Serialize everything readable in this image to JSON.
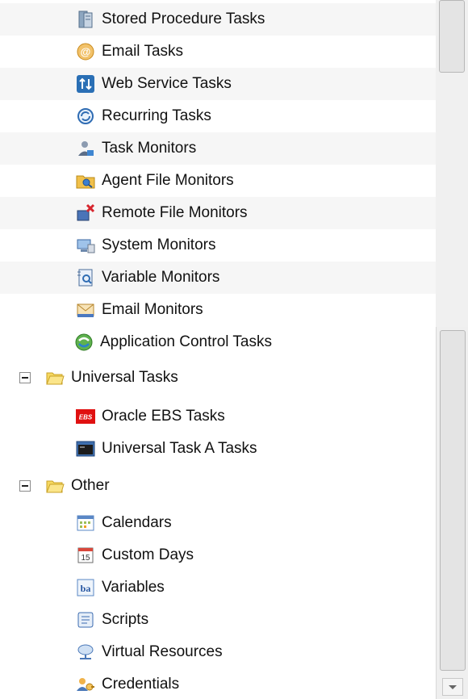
{
  "tree": {
    "task_items_top": [
      {
        "label": "Stored Procedure Tasks",
        "icon": "stored-procedure-icon"
      },
      {
        "label": "Email Tasks",
        "icon": "email-task-icon"
      },
      {
        "label": "Web Service Tasks",
        "icon": "web-service-icon"
      },
      {
        "label": "Recurring Tasks",
        "icon": "recurring-icon"
      },
      {
        "label": "Task Monitors",
        "icon": "task-monitor-icon"
      },
      {
        "label": "Agent File Monitors",
        "icon": "agent-file-monitor-icon"
      },
      {
        "label": "Remote File Monitors",
        "icon": "remote-file-monitor-icon"
      },
      {
        "label": "System Monitors",
        "icon": "system-monitor-icon"
      },
      {
        "label": "Variable Monitors",
        "icon": "variable-monitor-icon"
      },
      {
        "label": "Email Monitors",
        "icon": "email-monitor-icon"
      },
      {
        "label": "Application Control Tasks",
        "icon": "application-control-icon"
      }
    ],
    "universal_group": {
      "label": "Universal Tasks",
      "items": [
        {
          "label": "Oracle EBS Tasks",
          "icon": "oracle-ebs-icon",
          "badge": "EBS"
        },
        {
          "label": "Universal Task A Tasks",
          "icon": "universal-task-icon"
        }
      ]
    },
    "other_group": {
      "label": "Other",
      "items": [
        {
          "label": "Calendars",
          "icon": "calendar-icon"
        },
        {
          "label": "Custom Days",
          "icon": "custom-days-icon",
          "badge": "15"
        },
        {
          "label": "Variables",
          "icon": "variables-icon",
          "badge": "ba"
        },
        {
          "label": "Scripts",
          "icon": "scripts-icon"
        },
        {
          "label": "Virtual Resources",
          "icon": "virtual-resources-icon"
        },
        {
          "label": "Credentials",
          "icon": "credentials-icon"
        }
      ]
    }
  },
  "colors": {
    "folder_fill": "#f6d860",
    "folder_edge": "#c9a227",
    "ebs_red": "#e01010",
    "row_alt": "#f6f6f6"
  }
}
